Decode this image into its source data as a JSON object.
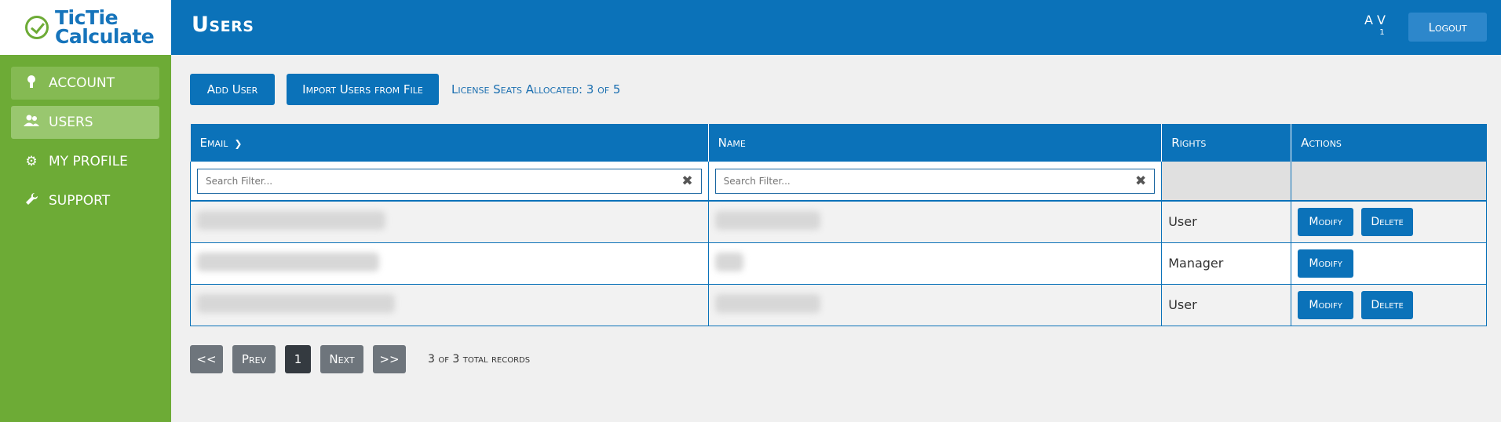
{
  "app": {
    "logo_line1": "TicTie",
    "logo_line2": "Calculate"
  },
  "sidebar": {
    "items": [
      {
        "label": "ACCOUNT",
        "icon": "award-icon"
      },
      {
        "label": "USERS",
        "icon": "users-icon"
      },
      {
        "label": "MY PROFILE",
        "icon": "gear-icon"
      },
      {
        "label": "SUPPORT",
        "icon": "wrench-icon"
      }
    ]
  },
  "header": {
    "title": "Users",
    "user_initials": "A V",
    "user_count": "1",
    "logout_label": "Logout"
  },
  "toolbar": {
    "add_user_label": "Add User",
    "import_label": "Import Users from File",
    "license_text": "License Seats Allocated: 3 of 5"
  },
  "table": {
    "columns": [
      "Email",
      "Name",
      "Rights",
      "Actions"
    ],
    "filter_placeholder": "Search Filter...",
    "rows": [
      {
        "rights": "User",
        "modify": "Modify",
        "delete": "Delete"
      },
      {
        "rights": "Manager",
        "modify": "Modify"
      },
      {
        "rights": "User",
        "modify": "Modify",
        "delete": "Delete"
      }
    ]
  },
  "pager": {
    "first": "<<",
    "prev": "Prev",
    "current": "1",
    "next": "Next",
    "last": ">>",
    "records": "3 of 3 total records"
  },
  "colors": {
    "primary": "#0b72b9",
    "sidebar": "#6dab36",
    "pager_button": "#6e757c",
    "pager_current": "#343a40"
  }
}
